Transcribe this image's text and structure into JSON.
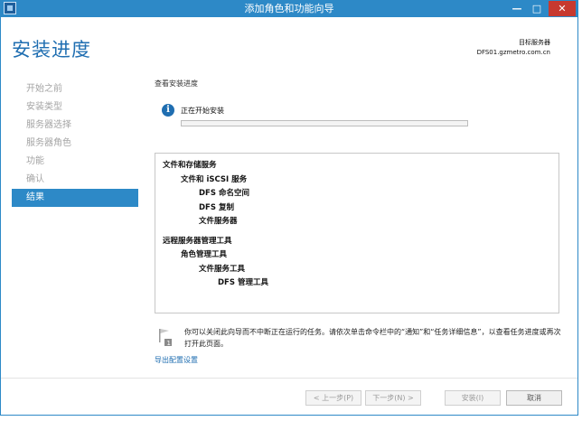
{
  "window": {
    "title": "添加角色和功能向导",
    "minimize": "—",
    "maximize": "□",
    "close": "✕"
  },
  "page": {
    "title": "安装进度",
    "target_label": "目标服务器",
    "target_server": "DFS01.gzmetro.com.cn"
  },
  "nav": {
    "items": [
      {
        "label": "开始之前",
        "active": false
      },
      {
        "label": "安装类型",
        "active": false
      },
      {
        "label": "服务器选择",
        "active": false
      },
      {
        "label": "服务器角色",
        "active": false
      },
      {
        "label": "功能",
        "active": false
      },
      {
        "label": "确认",
        "active": false
      },
      {
        "label": "结果",
        "active": true
      }
    ]
  },
  "content": {
    "section_label": "查看安装进度",
    "status_text": "正在开始安装",
    "progress": 0,
    "features": {
      "group1": "文件和存储服务",
      "g1_sub": "文件和 iSCSI 服务",
      "g1_items": [
        "DFS 命名空间",
        "DFS 复制",
        "文件服务器"
      ],
      "group2": "远程服务器管理工具",
      "g2_sub": "角色管理工具",
      "g2_sub2": "文件服务工具",
      "g2_item": "DFS 管理工具"
    },
    "notice": "你可以关闭此向导而不中断正在运行的任务。请依次单击命令栏中的“通知”和“任务详细信息”，以查看任务进度或再次打开此页面。",
    "export_link": "导出配置设置"
  },
  "buttons": {
    "prev": "< 上一步(P)",
    "next": "下一步(N) >",
    "install": "安装(I)",
    "cancel": "取消"
  },
  "colors": {
    "accent": "#2d89c7",
    "title": "#1f6eb1",
    "disabled_text": "#a4a4a4"
  }
}
